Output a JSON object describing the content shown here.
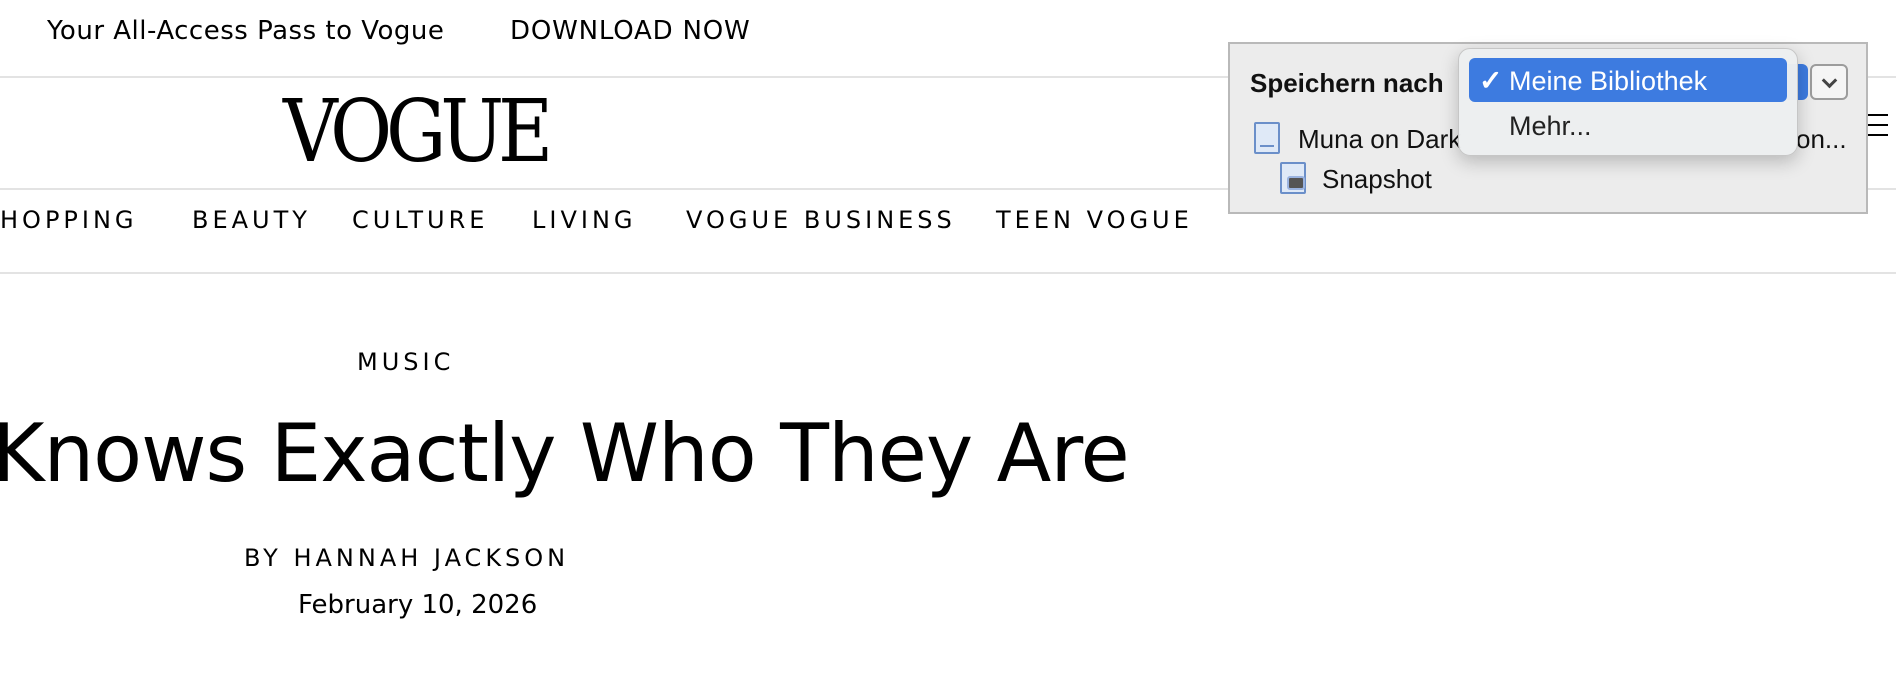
{
  "promo": {
    "text": "Your All-Access Pass to Vogue",
    "link": "DOWNLOAD NOW"
  },
  "header": {
    "logo": "VOGUE",
    "menu_icon": "hamburger-menu-icon"
  },
  "nav": {
    "items": [
      "HOPPING",
      "BEAUTY",
      "CULTURE",
      "LIVING",
      "VOGUE BUSINESS",
      "TEEN VOGUE"
    ]
  },
  "article": {
    "kicker": "MUSIC",
    "headline": "Knows Exactly Who They Are",
    "byline": "BY HANNAH JACKSON",
    "date": "February 10, 2026"
  },
  "save_popup": {
    "label": "Speichern nach",
    "document_title": "Muna on Dark",
    "document_title_end": "on...",
    "snapshot_label": "Snapshot",
    "dropdown": {
      "selected": "Meine Bibliothek",
      "check": "✓",
      "options": [
        "Mehr..."
      ]
    },
    "accent_color": "#3d7be0"
  }
}
